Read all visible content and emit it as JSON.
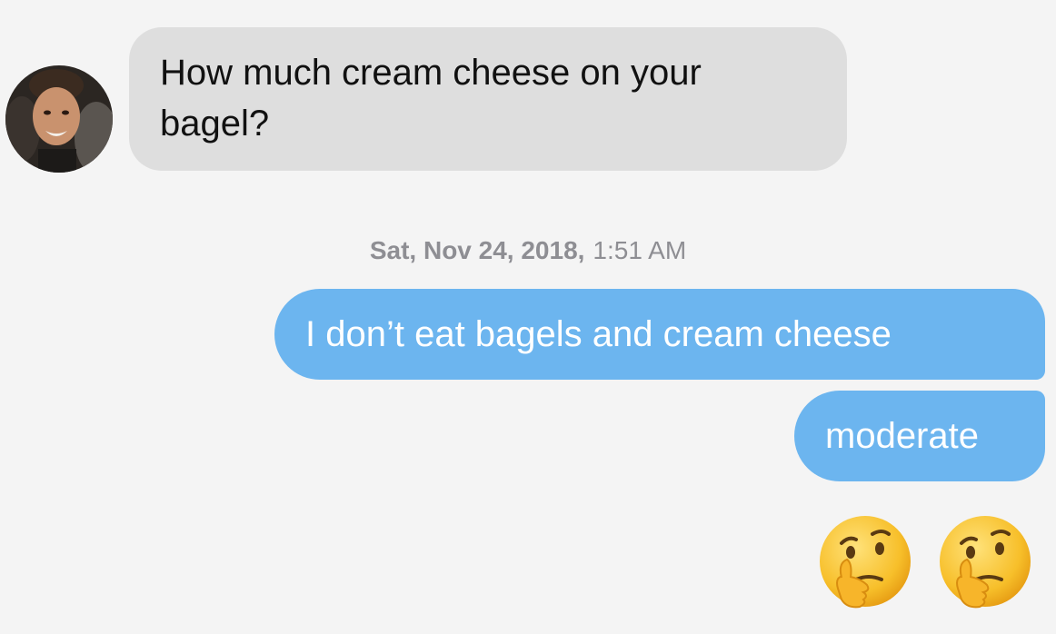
{
  "conversation": {
    "incoming": {
      "sender_avatar": "contact-avatar-photo",
      "text": "How much cream cheese on your bagel?"
    },
    "timestamp": {
      "date": "Sat, Nov 24, 2018,",
      "time": "1:51 AM"
    },
    "outgoing": [
      {
        "text": "I don’t eat bagels and cream cheese"
      },
      {
        "text": "moderate"
      }
    ],
    "reactions": [
      {
        "emoji": "thinking-face",
        "glyph": "🤔"
      },
      {
        "emoji": "thinking-face",
        "glyph": "🤔"
      }
    ]
  },
  "colors": {
    "background": "#f4f4f4",
    "incoming_bubble": "#dedede",
    "outgoing_bubble": "#6cb5ef",
    "timestamp_text": "#8e8e93"
  }
}
